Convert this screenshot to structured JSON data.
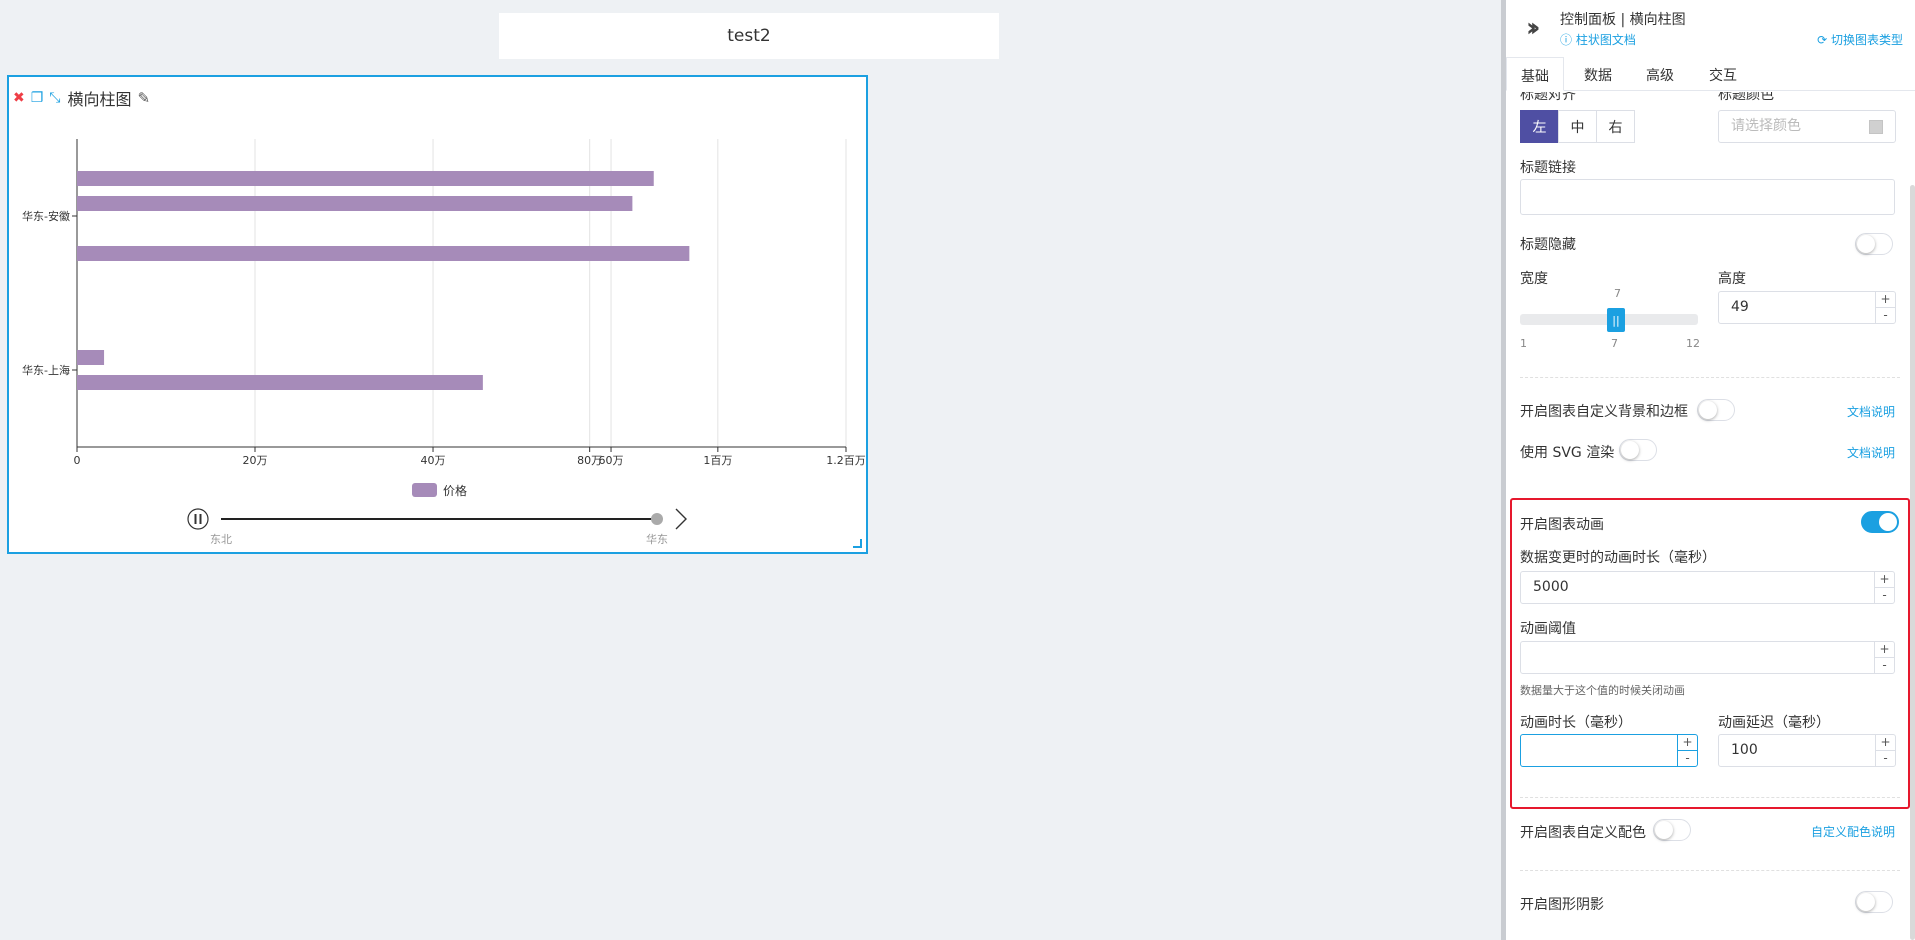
{
  "page": {
    "title": "test2"
  },
  "card": {
    "title": "横向柱图"
  },
  "chart_data": {
    "type": "bar",
    "orientation": "horizontal",
    "categories": [
      "华东-上海",
      "华东-安徽"
    ],
    "bars": [
      {
        "category": "华东-上海",
        "value": 38000
      },
      {
        "category": "华东-上海",
        "value": 570000
      },
      {
        "category": "华东-安徽",
        "value": 810000
      },
      {
        "category": "华东-安徽",
        "value": 780000
      },
      {
        "category": "华东-安徽",
        "value": 860000
      }
    ],
    "x_ticks": [
      {
        "value": 0,
        "label": "0"
      },
      {
        "value": 250000,
        "label": "20万"
      },
      {
        "value": 500000,
        "label": "40万"
      },
      {
        "value": 720000,
        "label": "80万"
      },
      {
        "value": 750000,
        "label": "60万"
      },
      {
        "value": 900000,
        "label": "1百万"
      },
      {
        "value": 1080000,
        "label": "1.2百万"
      }
    ],
    "xlim": [
      0,
      1080000
    ],
    "legend": {
      "label": "价格",
      "color": "#a68bb9",
      "position": "bottom"
    },
    "grid": true,
    "bar_color": "#a68bb9",
    "timeline": {
      "labels": [
        "东北",
        "华东"
      ],
      "current": "华东"
    }
  },
  "panel": {
    "title": "控制面板 | 横向柱图",
    "doc_link": "柱状图文档",
    "switch_type": "切换图表类型",
    "tabs": [
      "基础",
      "数据",
      "高级",
      "交互"
    ],
    "title_align_label": "标题对齐",
    "title_color_label": "标题颜色",
    "align_buttons": [
      "左",
      "中",
      "右"
    ],
    "color_placeholder": "请选择颜色",
    "title_link_label": "标题链接",
    "title_link_value": "",
    "title_hide_label": "标题隐藏",
    "width_label": "宽度",
    "height_label": "高度",
    "height_value": "49",
    "slider": {
      "value": "7",
      "min": "1",
      "mid": "7",
      "max": "12",
      "thumb": "||",
      "level": 0.545
    },
    "custom_bg_label": "开启图表自定义背景和边框",
    "doc_note": "文档说明",
    "svg_label": "使用 SVG 渲染",
    "doc_note2": "文档说明",
    "animation_label": "开启图表动画",
    "anim_update_label": "数据变更时的动画时长（毫秒）",
    "anim_update_value": "5000",
    "anim_threshold_label": "动画阈值",
    "anim_threshold_value": "",
    "anim_threshold_hint": "数据量大于这个值的时候关闭动画",
    "anim_duration_label": "动画时长（毫秒）",
    "anim_duration_value": "",
    "anim_delay_label": "动画延迟（毫秒）",
    "anim_delay_value": "100",
    "custom_color_label": "开启图表自定义配色",
    "custom_color_note": "自定义配色说明",
    "shadow_label": "开启图形阴影",
    "plus": "+",
    "minus": "-"
  }
}
